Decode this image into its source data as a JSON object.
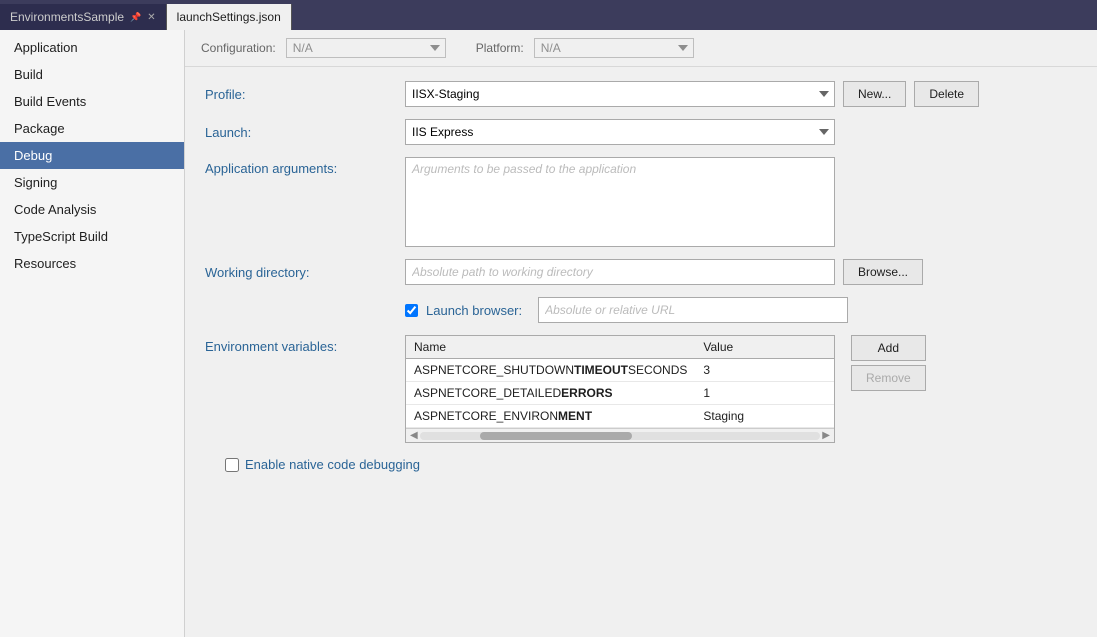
{
  "tabs": [
    {
      "id": "environments-sample",
      "label": "EnvironmentsSample",
      "active": false,
      "pinned": true,
      "closeable": true
    },
    {
      "id": "launch-settings",
      "label": "launchSettings.json",
      "active": true,
      "pinned": false,
      "closeable": false
    }
  ],
  "sidebar": {
    "items": [
      {
        "id": "application",
        "label": "Application",
        "active": false
      },
      {
        "id": "build",
        "label": "Build",
        "active": false
      },
      {
        "id": "build-events",
        "label": "Build Events",
        "active": false
      },
      {
        "id": "package",
        "label": "Package",
        "active": false
      },
      {
        "id": "debug",
        "label": "Debug",
        "active": true
      },
      {
        "id": "signing",
        "label": "Signing",
        "active": false
      },
      {
        "id": "code-analysis",
        "label": "Code Analysis",
        "active": false
      },
      {
        "id": "typescript-build",
        "label": "TypeScript Build",
        "active": false
      },
      {
        "id": "resources",
        "label": "Resources",
        "active": false
      }
    ]
  },
  "config_bar": {
    "configuration_label": "Configuration:",
    "configuration_value": "N/A",
    "platform_label": "Platform:",
    "platform_value": "N/A"
  },
  "form": {
    "profile_label": "Profile:",
    "profile_value": "IISX-Staging",
    "profile_options": [
      "IISX-Staging"
    ],
    "launch_label": "Launch:",
    "launch_value": "IIS Express",
    "launch_options": [
      "IIS Express"
    ],
    "app_args_label": "Application arguments:",
    "app_args_placeholder": "Arguments to be passed to the application",
    "working_dir_label": "Working directory:",
    "working_dir_placeholder": "Absolute path to working directory",
    "launch_browser_label": "Launch browser:",
    "launch_browser_checked": true,
    "launch_browser_url_placeholder": "Absolute or relative URL",
    "env_vars_label": "Environment variables:",
    "env_vars_col_name": "Name",
    "env_vars_col_value": "Value",
    "env_vars": [
      {
        "name": "ASPNETCORE_SHUTDOWNTIMEOUTSECONDS",
        "name_bold": "TIMEOUT",
        "name_prefix": "ASPNETCORE_SHUTDOWN",
        "name_suffix": "SECONDS",
        "value": "3"
      },
      {
        "name": "ASPNETCORE_DETAILEDERRORS",
        "name_bold": "ERRORS",
        "name_prefix": "ASPNETCORE_DETAILED",
        "name_suffix": "",
        "value": "1"
      },
      {
        "name": "ASPNETCORE_ENVIRONMENT",
        "name_bold": "MENT",
        "name_prefix": "ASPNETCORE_ENVIRON",
        "name_suffix": "",
        "value": "Staging"
      }
    ],
    "new_button": "New...",
    "delete_button": "Delete",
    "browse_button": "Browse...",
    "add_button": "Add",
    "remove_button": "Remove",
    "native_debug_label": "Enable native code debugging",
    "native_debug_checked": false
  }
}
